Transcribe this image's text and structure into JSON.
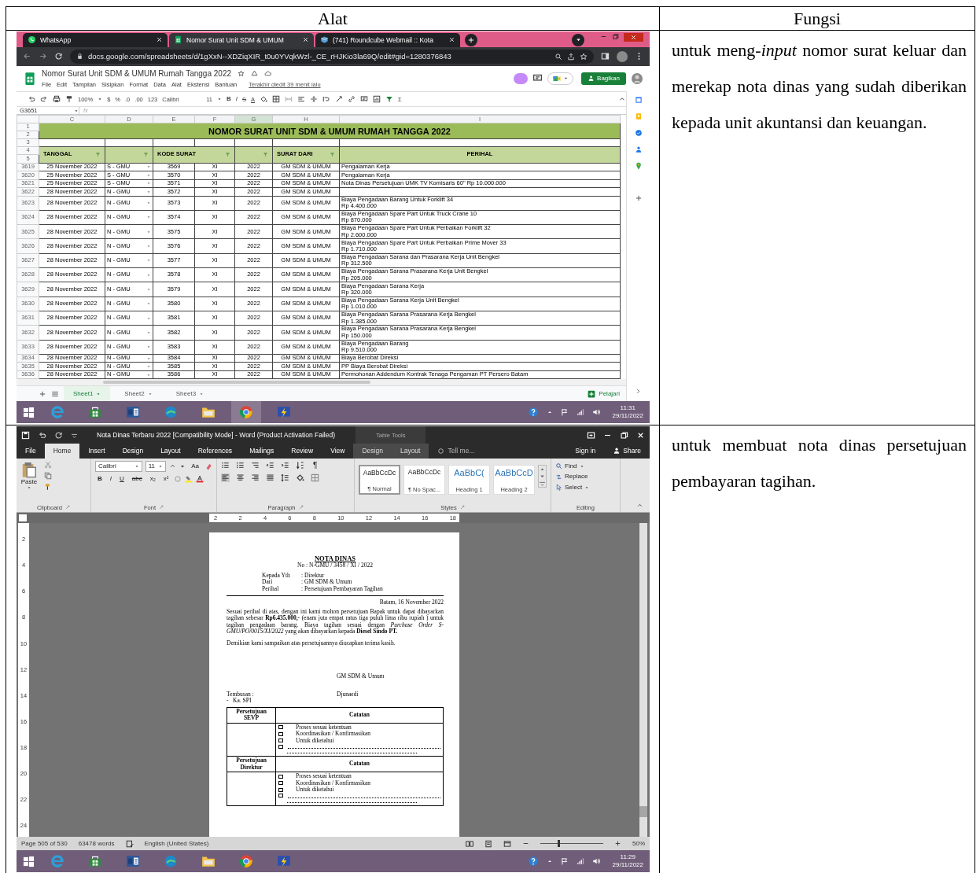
{
  "table": {
    "columns": [
      "Alat",
      "Fungsi"
    ],
    "rows": [
      {
        "kind": "sheets",
        "description": "untuk meng-*input* nomor surat keluar dan merekap nota dinas yang sudah diberikan kepada unit akuntansi dan keuangan.",
        "screen": {
          "browser_tabs": [
            {
              "title": "WhatsApp",
              "selected": false
            },
            {
              "title": "Nomor Surat Unit SDM & UMUM",
              "selected": true
            },
            {
              "title": "(741) Roundcube Webmail :: Kota",
              "selected": false
            }
          ],
          "url": "docs.google.com/spreadsheets/d/1gXxN--XDZiqXIR_t0u0YVqkWzl-_CE_rHJKio3la69Q/edit#gid=1280376843",
          "doc_title": "Nomor Surat Unit SDM & UMUM Rumah Tangga 2022",
          "menu": [
            "File",
            "Edit",
            "Tampilan",
            "Sisipkan",
            "Format",
            "Data",
            "Alat",
            "Ekstensi",
            "Bantuan"
          ],
          "last_edit": "Terakhir diedit 39 menit lalu",
          "share": "Bagikan",
          "toolbar": {
            "zoom": "100%",
            "currency": "$",
            "percent": "%",
            "decimal_less": ".0",
            "decimal_more": ".00",
            "number_format": "123",
            "font": "Calibri",
            "size": "11",
            "bold": "B",
            "italic": "I",
            "strike": "S",
            "text_color": "A",
            "sum": "Σ"
          },
          "cell_ref": "G3651",
          "formula_label": "fx",
          "column_letters": [
            {
              "label": "C",
              "selected": false
            },
            {
              "label": "D",
              "selected": false
            },
            {
              "label": "E",
              "selected": false
            },
            {
              "label": "F",
              "selected": false
            },
            {
              "label": "G",
              "selected": true
            },
            {
              "label": "H",
              "selected": false
            },
            {
              "label": "I",
              "selected": false
            }
          ],
          "title_rows": [
            "1",
            "2",
            "3",
            "4",
            "5"
          ],
          "sheet_title": "NOMOR SURAT UNIT SDM & UMUM RUMAH TANGGA 2022",
          "headers": [
            {
              "label": "TANGGAL",
              "filter": true
            },
            {
              "filter": true
            },
            {
              "label": "KODE SURAT",
              "filter": true
            },
            {
              "filter": true
            },
            {
              "label": "SURAT DARI",
              "filter": true
            },
            {
              "label": "PERIHAL",
              "filter": false
            }
          ],
          "rows": [
            {
              "row": "3619",
              "date": "25 November 2022",
              "type": "S - GMU",
              "code": "3569",
              "month": "XI",
              "year": "2022",
              "from": "GM SDM & UMUM",
              "subject": "Pengalaman Kerja"
            },
            {
              "row": "3620",
              "date": "25 November 2022",
              "type": "S - GMU",
              "code": "3570",
              "month": "XI",
              "year": "2022",
              "from": "GM SDM & UMUM",
              "subject": "Pengalaman Kerja"
            },
            {
              "row": "3621",
              "date": "25 November 2022",
              "type": "S - GMU",
              "code": "3571",
              "month": "XI",
              "year": "2022",
              "from": "GM SDM & UMUM",
              "subject": "Nota Dinas Persetujuan UMK TV Komisaris 60\" Rp 10.000.000"
            },
            {
              "row": "3622",
              "date": "28 November 2022",
              "type": "N - GMU",
              "code": "3572",
              "month": "XI",
              "year": "2022",
              "from": "GM SDM & UMUM"
            },
            {
              "row": "3623",
              "date": "28 November 2022",
              "type": "N - GMU",
              "code": "3573",
              "month": "XI",
              "year": "2022",
              "from": "GM SDM & UMUM",
              "subject": "Biaya Pengadaan Barang Untuk Forklift 34",
              "amount": "Rp 4.400.000"
            },
            {
              "row": "3624",
              "date": "28 November 2022",
              "type": "N - GMU",
              "code": "3574",
              "month": "XI",
              "year": "2022",
              "from": "GM SDM & UMUM",
              "subject": "Biaya Pengadaan Spare Part Untuk Truck Crane 10",
              "amount": "Rp 870.000"
            },
            {
              "row": "3625",
              "date": "28 November 2022",
              "type": "N - GMU",
              "code": "3575",
              "month": "XI",
              "year": "2022",
              "from": "GM SDM & UMUM",
              "subject": "Biaya Pengadaan Spare Part Untuk Perbaikan Forklift 32",
              "amount": "Rp 2.600.000"
            },
            {
              "row": "3626",
              "date": "28 November 2022",
              "type": "N - GMU",
              "code": "3576",
              "month": "XI",
              "year": "2022",
              "from": "GM SDM & UMUM",
              "subject": "Biaya Pengadaan Spare Part Untuk Perbaikan Prime Mover 33",
              "amount": "Rp 1.710.000"
            },
            {
              "row": "3627",
              "date": "28 November 2022",
              "type": "N - GMU",
              "code": "3577",
              "month": "XI",
              "year": "2022",
              "from": "GM SDM & UMUM",
              "subject": "Biaya Pengadaan Sarana dan Prasarana Kerja Unit Bengkel",
              "amount": "Rp 312.500"
            },
            {
              "row": "3628",
              "date": "28 November 2022",
              "type": "N - GMU",
              "code": "3578",
              "month": "XI",
              "year": "2022",
              "from": "GM SDM & UMUM",
              "subject": "Biaya Pengadaan Sarana Prasarana Kerja Unit Bengkel",
              "amount": "Rp 205.000"
            },
            {
              "row": "3629",
              "date": "28 November 2022",
              "type": "N - GMU",
              "code": "3579",
              "month": "XI",
              "year": "2022",
              "from": "GM SDM & UMUM",
              "subject": "Biaya Pengadaan Sarana Kerja",
              "amount": "Rp 320.000"
            },
            {
              "row": "3630",
              "date": "28 November 2022",
              "type": "N - GMU",
              "code": "3580",
              "month": "XI",
              "year": "2022",
              "from": "GM SDM & UMUM",
              "subject": "Biaya Pengadaan Sarana Kerja Unit Bengkel",
              "amount": "Rp 1.010.000"
            },
            {
              "row": "3631",
              "date": "28 November 2022",
              "type": "N - GMU",
              "code": "3581",
              "month": "XI",
              "year": "2022",
              "from": "GM SDM & UMUM",
              "subject": "Biaya Pengadaan Sarana Prasarana Kerja Bengkel",
              "amount": "Rp 1.385.000"
            },
            {
              "row": "3632",
              "date": "28 November 2022",
              "type": "N - GMU",
              "code": "3582",
              "month": "XI",
              "year": "2022",
              "from": "GM SDM & UMUM",
              "subject": "Biaya Pengadaan Sarana Prasarana Kerja Bengkel",
              "amount": "Rp 150.000"
            },
            {
              "row": "3633",
              "date": "28 November 2022",
              "type": "N - GMU",
              "code": "3583",
              "month": "XI",
              "year": "2022",
              "from": "GM SDM & UMUM",
              "subject": "Biaya Pengadaan Barang",
              "amount": "Rp 9.510.000"
            },
            {
              "row": "3634",
              "date": "28 November 2022",
              "type": "N - GMU",
              "code": "3584",
              "month": "XI",
              "year": "2022",
              "from": "GM SDM & UMUM",
              "subject": "Biaya Berobat Direksi"
            },
            {
              "row": "3635",
              "date": "28 November 2022",
              "type": "N - GMU",
              "code": "3585",
              "month": "XI",
              "year": "2022",
              "from": "GM SDM & UMUM",
              "subject": "PP Biaya Berobat Direksi"
            },
            {
              "row": "3636",
              "date": "28 November 2022",
              "type": "N - GMU",
              "code": "3586",
              "month": "XI",
              "year": "2022",
              "from": "GM SDM & UMUM",
              "subject": "Permohonan Addendum Kontrak Tenaga Pengaman PT Persero Batam"
            }
          ],
          "sheet_tabs": [
            {
              "label": "Sheet1",
              "selected": true
            },
            {
              "label": "Sheet2",
              "selected": false
            },
            {
              "label": "Sheet3",
              "selected": false
            }
          ],
          "explore": "Pelajari",
          "taskbar": {
            "time": "11:31",
            "date": "29/11/2022"
          }
        }
      },
      {
        "kind": "word",
        "description": "untuk membuat nota dinas persetujuan pembayaran tagihan.",
        "screen": {
          "title": "Nota Dinas Terbaru 2022 [Compatibility Mode] - Word (Product Activation Failed)",
          "context_title": "Table Tools",
          "tabs": [
            {
              "label": "File",
              "selected": false,
              "contextual": false
            },
            {
              "label": "Home",
              "selected": true,
              "contextual": false
            },
            {
              "label": "Insert",
              "selected": false,
              "contextual": false
            },
            {
              "label": "Design",
              "selected": false,
              "contextual": false
            },
            {
              "label": "Layout",
              "selected": false,
              "contextual": false
            },
            {
              "label": "References",
              "selected": false,
              "contextual": false
            },
            {
              "label": "Mailings",
              "selected": false,
              "contextual": false
            },
            {
              "label": "Review",
              "selected": false,
              "contextual": false
            },
            {
              "label": "View",
              "selected": false,
              "contextual": false
            },
            {
              "label": "Design",
              "selected": false,
              "contextual": true
            },
            {
              "label": "Layout",
              "selected": false,
              "contextual": true
            }
          ],
          "tell_me": "Tell me...",
          "sign_in": "Sign in",
          "share": "Share",
          "paste": "Paste",
          "font": "Calibri",
          "size": "11",
          "case": "Aa",
          "font_buttons": [
            "B",
            "I",
            "U",
            "abc",
            "x₂",
            "x²"
          ],
          "pilcrow": "¶",
          "styles": [
            {
              "preview": "AaBbCcDc",
              "label": "¶ Normal",
              "kind": "body",
              "selected": true
            },
            {
              "preview": "AaBbCcDc",
              "label": "¶ No Spac...",
              "kind": "body",
              "selected": false
            },
            {
              "preview": "AaBbC(",
              "label": "Heading 1",
              "kind": "heading",
              "selected": false
            },
            {
              "preview": "AaBbCcD",
              "label": "Heading 2",
              "kind": "heading",
              "selected": false
            }
          ],
          "editing": [
            "Find",
            "Replace",
            "Select"
          ],
          "groups": [
            "Clipboard",
            "Font",
            "Paragraph",
            "Styles",
            "Editing"
          ],
          "ruler": [
            "2",
            "2",
            "4",
            "6",
            "8",
            "10",
            "12",
            "14",
            "16",
            "18"
          ],
          "vertical_ruler": [
            "2",
            "4",
            "6",
            "8",
            "10",
            "12",
            "14",
            "16",
            "18",
            "20",
            "22",
            "24"
          ],
          "document": {
            "title": "NOTA DINAS",
            "number": "No : N-GMU / 3458 / XI / 2022",
            "address": [
              {
                "label": "Kepada Yth",
                "value": ": Direktur"
              },
              {
                "label": "Dari",
                "value": ": GM SDM & Umum"
              },
              {
                "label": "Perihal",
                "value": ": Persetujuan Pembayaran Tagihan"
              }
            ],
            "place_date": "Batam, 16 November 2022",
            "body": "Sesuai perihal di atas, dengan ini kami mohon persetujuan Bapak untuk dapat dibayarkan tagihan sebesar **Rp6.435.000,-** (enam juta empat ratus tiga puluh lima ribu rupiah ) untuk tagihan pengadaan barang. Biaya tagihan sesuai dengan *Purchase Order S-GMU/PO/0015/XI/2022* yang akan dibayarkan kepada **Diesel Sindo PT.**",
            "closing": "Demikian kami sampaikan atas persetujuannya diucapkan terima kasih.",
            "signer_title": "GM SDM & Umum",
            "signer_name": "Djunaedi",
            "cc_label": "Tembusan :",
            "cc": [
              "-   Ka. SPI"
            ],
            "approvals": [
              {
                "title": "Persetujuan SEVP",
                "notes_label": "Catatan",
                "options": [
                  "Proses sesuai ketentuan",
                  "Koordinasikan / Konfirmasikan",
                  "Untuk diketahui"
                ]
              },
              {
                "title": "Persetujuan Direktur",
                "notes_label": "Catatan",
                "options": [
                  "Proses sesuai ketentuan",
                  "Koordinasikan / Konfirmasikan",
                  "Untuk diketahui"
                ]
              }
            ]
          },
          "status": {
            "page": "Page 505 of 530",
            "words": "63478 words",
            "language": "English (United States)",
            "zoom": "50%"
          },
          "zoom_slider": {
            "level": 0.27
          },
          "taskbar": {
            "time": "11:29",
            "date": "29/11/2022"
          }
        }
      }
    ]
  }
}
